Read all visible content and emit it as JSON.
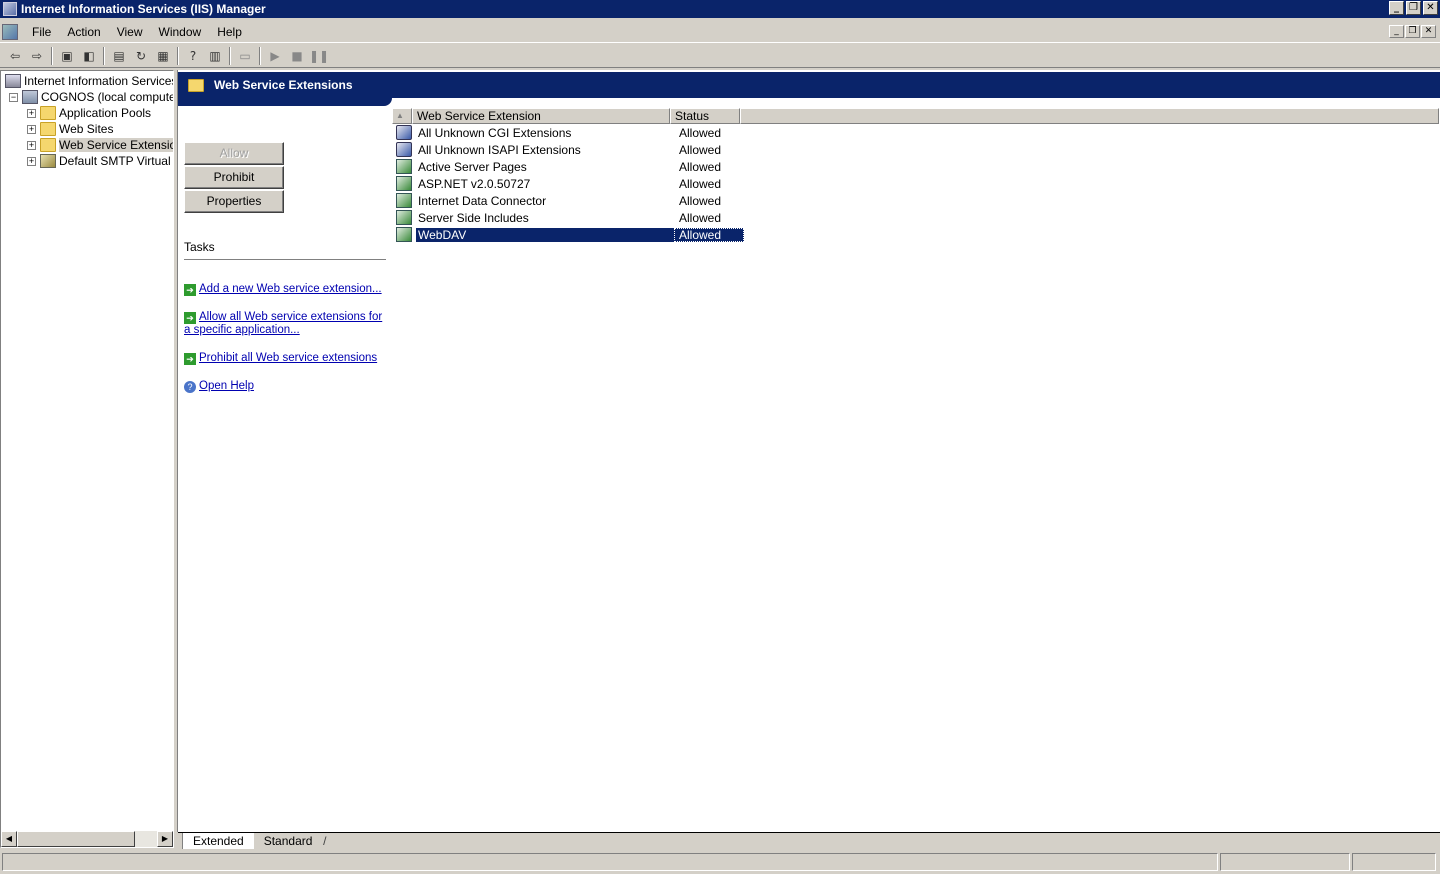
{
  "window": {
    "title": "Internet Information Services (IIS) Manager",
    "minimize": "_",
    "restore": "❐",
    "close": "✕"
  },
  "menu": {
    "items": [
      "File",
      "Action",
      "View",
      "Window",
      "Help"
    ]
  },
  "toolbar": {
    "icons": [
      "back-icon",
      "forward-icon",
      "up-folder-icon",
      "show-hide-tree-icon",
      "properties-icon",
      "refresh-icon",
      "export-list-icon",
      "help-icon",
      "console-tree-icon",
      "computer-icon",
      "play-icon",
      "stop-icon",
      "pause-icon"
    ]
  },
  "tree": {
    "root": "Internet Information Services",
    "computer": "COGNOS (local computer)",
    "children": [
      {
        "label": "Application Pools",
        "expander": "+"
      },
      {
        "label": "Web Sites",
        "expander": "+"
      },
      {
        "label": "Web Service Extensions",
        "expander": "+"
      },
      {
        "label": "Default SMTP Virtual Server",
        "expander": "+"
      }
    ],
    "computer_expander": "−"
  },
  "panel": {
    "header_title": "Web Service Extensions",
    "buttons": {
      "allow": "Allow",
      "prohibit": "Prohibit",
      "properties": "Properties"
    },
    "tasks_title": "Tasks",
    "tasks": [
      "Add a new Web service extension...",
      "Allow all Web service extensions for a specific application...",
      "Prohibit all Web service extensions",
      "Open Help"
    ]
  },
  "list": {
    "sort_indicator": "▲",
    "columns": [
      "Web Service Extension",
      "Status"
    ],
    "rows": [
      {
        "name": "All Unknown CGI Extensions",
        "status": "Allowed",
        "icon": "unknown-extension-icon"
      },
      {
        "name": "All Unknown ISAPI Extensions",
        "status": "Allowed",
        "icon": "unknown-extension-icon"
      },
      {
        "name": "Active Server Pages",
        "status": "Allowed",
        "icon": "extension-icon"
      },
      {
        "name": "ASP.NET v2.0.50727",
        "status": "Allowed",
        "icon": "extension-icon"
      },
      {
        "name": "Internet Data Connector",
        "status": "Allowed",
        "icon": "extension-icon"
      },
      {
        "name": "Server Side Includes",
        "status": "Allowed",
        "icon": "extension-icon"
      },
      {
        "name": "WebDAV",
        "status": "Allowed",
        "icon": "extension-icon",
        "selected": true
      }
    ]
  },
  "tabs": [
    "Extended",
    "Standard"
  ],
  "colors": {
    "title_bar": "#0a246a",
    "chrome": "#d4d0c8",
    "link": "#0000b0",
    "selection": "#0a246a"
  }
}
